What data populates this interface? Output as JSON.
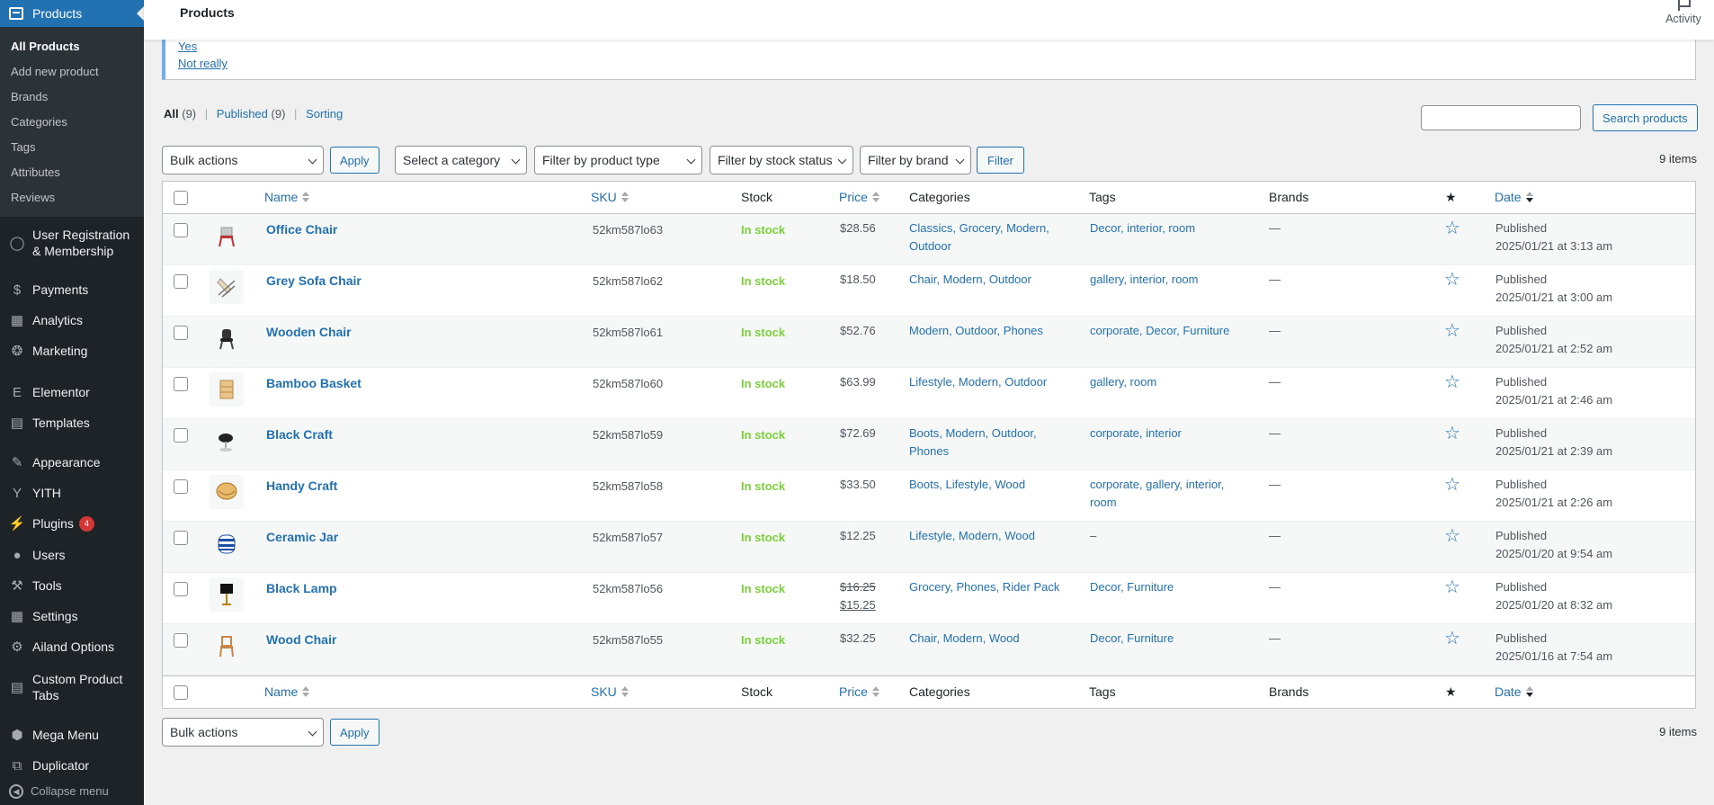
{
  "header": {
    "title": "Products",
    "activity_label": "Activity"
  },
  "sidebar": {
    "current": {
      "label": "Products",
      "icon": "products-icon"
    },
    "submenu": [
      {
        "label": "All Products",
        "current": true
      },
      {
        "label": "Add new product"
      },
      {
        "label": "Brands"
      },
      {
        "label": "Categories"
      },
      {
        "label": "Tags"
      },
      {
        "label": "Attributes"
      },
      {
        "label": "Reviews"
      }
    ],
    "items": [
      {
        "label": "User Registration\n& Membership",
        "icon": "user-registration-icon"
      },
      {
        "label": "Payments",
        "icon": "payments-icon"
      },
      {
        "label": "Analytics",
        "icon": "analytics-icon"
      },
      {
        "label": "Marketing",
        "icon": "marketing-icon"
      },
      {
        "label": "Elementor",
        "icon": "elementor-icon"
      },
      {
        "label": "Templates",
        "icon": "templates-icon"
      },
      {
        "label": "Appearance",
        "icon": "appearance-icon"
      },
      {
        "label": "YITH",
        "icon": "yith-icon"
      },
      {
        "label": "Plugins",
        "icon": "plugins-icon",
        "badge": "4"
      },
      {
        "label": "Users",
        "icon": "users-icon"
      },
      {
        "label": "Tools",
        "icon": "tools-icon"
      },
      {
        "label": "Settings",
        "icon": "settings-icon"
      },
      {
        "label": "Ailand Options",
        "icon": "ailand-options-icon"
      },
      {
        "label": "Custom Product\nTabs",
        "icon": "custom-product-tabs-icon"
      },
      {
        "label": "Mega Menu",
        "icon": "mega-menu-icon"
      },
      {
        "label": "Duplicator",
        "icon": "duplicator-icon"
      }
    ],
    "collapse_label": "Collapse menu"
  },
  "notice": {
    "yes_label": "Yes",
    "no_label": "Not really"
  },
  "views": {
    "all_label": "All",
    "all_count": "(9)",
    "published_label": "Published",
    "published_count": "(9)",
    "sorting_label": "Sorting"
  },
  "search": {
    "placeholder": "",
    "button_label": "Search products"
  },
  "filters": {
    "bulk_actions": "Bulk actions",
    "apply_label": "Apply",
    "category": "Select a category",
    "product_type": "Filter by product type",
    "stock_status": "Filter by stock status",
    "brand": "Filter by brand",
    "filter_label": "Filter"
  },
  "items_count": "9 items",
  "columns": {
    "name": "Name",
    "sku": "SKU",
    "stock": "Stock",
    "price": "Price",
    "categories": "Categories",
    "tags": "Tags",
    "brands": "Brands",
    "date": "Date"
  },
  "colors": {
    "accent": "#2271b1",
    "sidebar_bg": "#1d2327",
    "in_stock": "#7ad03a"
  },
  "products": [
    {
      "name": "Office Chair",
      "sku": "52km587lo63",
      "stock": "In stock",
      "price": "$28.56",
      "categories": "Classics, Grocery, Modern,\nOutdoor",
      "tags": "Decor, interior, room",
      "brands": "—",
      "status": "Published",
      "date": "2025/01/21 at 3:13 am",
      "thumb": "office-chair-thumb"
    },
    {
      "name": "Grey Sofa Chair",
      "sku": "52km587lo62",
      "stock": "In stock",
      "price": "$18.50",
      "categories": "Chair, Modern, Outdoor",
      "tags": "gallery, interior, room",
      "brands": "—",
      "status": "Published",
      "date": "2025/01/21 at 3:00 am",
      "thumb": "sofa-chair-thumb"
    },
    {
      "name": "Wooden Chair",
      "sku": "52km587lo61",
      "stock": "In stock",
      "price": "$52.76",
      "categories": "Modern, Outdoor, Phones",
      "tags": "corporate, Decor, Furniture",
      "brands": "—",
      "status": "Published",
      "date": "2025/01/21 at 2:52 am",
      "thumb": "wooden-chair-thumb"
    },
    {
      "name": "Bamboo Basket",
      "sku": "52km587lo60",
      "stock": "In stock",
      "price": "$63.99",
      "categories": "Lifestyle, Modern, Outdoor",
      "tags": "gallery, room",
      "brands": "—",
      "status": "Published",
      "date": "2025/01/21 at 2:46 am",
      "thumb": "bamboo-basket-thumb"
    },
    {
      "name": "Black Craft",
      "sku": "52km587lo59",
      "stock": "In stock",
      "price": "$72.69",
      "categories": "Boots, Modern, Outdoor,\nPhones",
      "tags": "corporate, interior",
      "brands": "—",
      "status": "Published",
      "date": "2025/01/21 at 2:39 am",
      "thumb": "black-craft-thumb"
    },
    {
      "name": "Handy Craft",
      "sku": "52km587lo58",
      "stock": "In stock",
      "price": "$33.50",
      "categories": "Boots, Lifestyle, Wood",
      "tags": "corporate, gallery, interior,\nroom",
      "brands": "—",
      "status": "Published",
      "date": "2025/01/21 at 2:26 am",
      "thumb": "handy-craft-thumb"
    },
    {
      "name": "Ceramic Jar",
      "sku": "52km587lo57",
      "stock": "In stock",
      "price": "$12.25",
      "categories": "Lifestyle, Modern, Wood",
      "tags": "–",
      "brands": "—",
      "status": "Published",
      "date": "2025/01/20 at 9:54 am",
      "thumb": "ceramic-jar-thumb"
    },
    {
      "name": "Black Lamp",
      "sku": "52km587lo56",
      "stock": "In stock",
      "price": "$15.25",
      "regular_price": "$16.25",
      "categories": "Grocery, Phones, Rider Pack",
      "tags": "Decor, Furniture",
      "brands": "—",
      "status": "Published",
      "date": "2025/01/20 at 8:32 am",
      "thumb": "black-lamp-thumb"
    },
    {
      "name": "Wood Chair",
      "sku": "52km587lo55",
      "stock": "In stock",
      "price": "$32.25",
      "categories": "Chair, Modern, Wood",
      "tags": "Decor, Furniture",
      "brands": "—",
      "status": "Published",
      "date": "2025/01/16 at 7:54 am",
      "thumb": "wood-chair-thumb"
    }
  ]
}
